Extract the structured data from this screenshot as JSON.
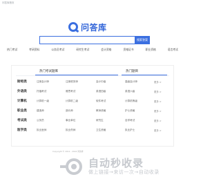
{
  "top_note": "问答库首页",
  "logo": {
    "text": "问答库"
  },
  "search": {
    "placeholder": "",
    "button_label": "搜索答案"
  },
  "nav": [
    "热门考试",
    "考研资料",
    "公务员考试",
    "研究生考试",
    "会计资格",
    "资格证书",
    "职业资格",
    "语言考试"
  ],
  "panel": {
    "left_title": "热门考试题库",
    "right_title": "热门题目",
    "more_label": "更多 >",
    "categories": [
      {
        "name": "财经类",
        "items": [
          "注册会计师",
          "注册税务师",
          "会计中级",
          "高级会计师"
        ]
      },
      {
        "name": "外语类",
        "items": [
          "托福考试",
          "雅思考试",
          "英语四级",
          "英语六级"
        ]
      },
      {
        "name": "计算机",
        "items": [
          "计算机一级",
          "计算机二级",
          "软件考试",
          "计算机等级"
        ]
      },
      {
        "name": "职业类",
        "items": [
          "建造师",
          "造价师",
          "教师资格",
          "护士资格"
        ]
      },
      {
        "name": "考试类",
        "items": [
          "公务员",
          "事业单位",
          "研究生",
          "自学考试"
        ]
      },
      {
        "name": "医学类",
        "items": [
          "执业医师",
          "执业药师",
          "卫生资格",
          "执业护士"
        ]
      }
    ]
  },
  "footer": "Copyright © 2012 - 2024 问答库",
  "watermark": {
    "title": "自动秒收录",
    "subtitle": "做上链接→来访一次→自动收录"
  }
}
